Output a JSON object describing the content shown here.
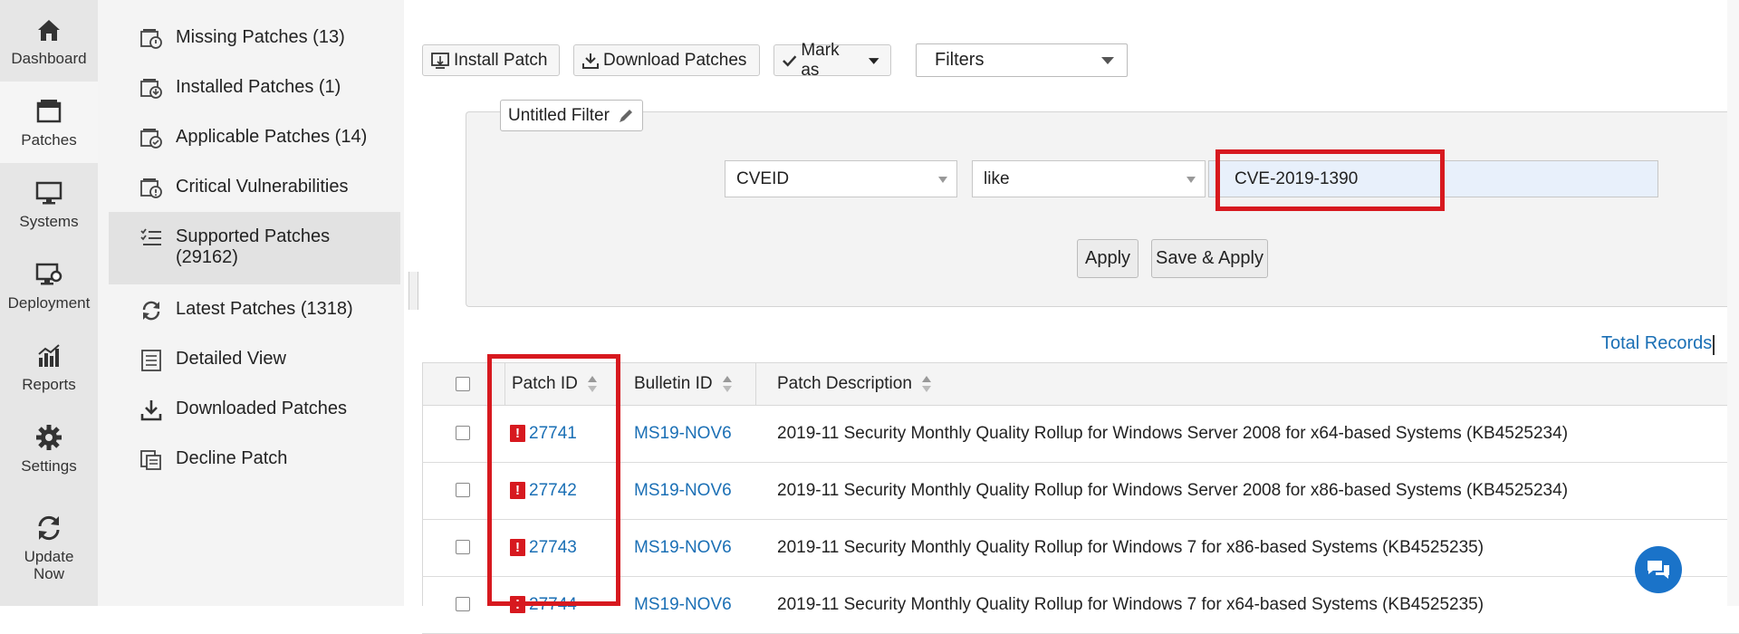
{
  "rail": {
    "items": [
      {
        "label": "Dashboard",
        "icon": "home-icon"
      },
      {
        "label": "Patches",
        "icon": "patches-icon",
        "active": true
      },
      {
        "label": "Systems",
        "icon": "monitor-icon"
      },
      {
        "label": "Deployment",
        "icon": "deployment-icon"
      },
      {
        "label": "Reports",
        "icon": "reports-icon"
      },
      {
        "label": "Settings",
        "icon": "gear-icon"
      },
      {
        "label": "Update Now",
        "icon": "refresh-icon"
      }
    ]
  },
  "sidebar": {
    "items": [
      {
        "label": "Missing Patches (13)",
        "icon": "missing-patches-icon"
      },
      {
        "label": "Installed Patches (1)",
        "icon": "installed-patches-icon"
      },
      {
        "label": "Applicable Patches (14)",
        "icon": "applicable-patches-icon"
      },
      {
        "label": "Critical Vulnerabilities",
        "icon": "critical-vulnerabilities-icon"
      },
      {
        "label": "Supported Patches",
        "label2": "(29162)",
        "icon": "checklist-icon",
        "active": true
      },
      {
        "label": "Latest Patches (1318)",
        "icon": "refresh-icon"
      },
      {
        "label": "Detailed View",
        "icon": "list-icon"
      },
      {
        "label": "Downloaded Patches",
        "icon": "download-icon"
      },
      {
        "label": "Decline Patch",
        "icon": "decline-icon"
      }
    ]
  },
  "toolbar": {
    "install_label": "Install Patch",
    "download_label": "Download Patches",
    "mark_label": "Mark as",
    "filters_value": "Filters"
  },
  "filter": {
    "name": "Untitled Filter",
    "field_value": "CVEID",
    "operator_value": "like",
    "search_value": "CVE-2019-1390",
    "apply_label": "Apply",
    "save_apply_label": "Save & Apply"
  },
  "total_label": "Total Records",
  "table": {
    "headers": [
      "Patch ID",
      "Bulletin ID",
      "Patch Description"
    ],
    "rows": [
      {
        "patch_id": "27741",
        "bulletin": "MS19-NOV6",
        "desc": "2019-11 Security Monthly Quality Rollup for Windows Server 2008 for x64-based Systems (KB4525234)"
      },
      {
        "patch_id": "27742",
        "bulletin": "MS19-NOV6",
        "desc": "2019-11 Security Monthly Quality Rollup for Windows Server 2008 for x86-based Systems (KB4525234)"
      },
      {
        "patch_id": "27743",
        "bulletin": "MS19-NOV6",
        "desc": "2019-11 Security Monthly Quality Rollup for Windows 7 for x86-based Systems (KB4525235)"
      },
      {
        "patch_id": "27744",
        "bulletin": "MS19-NOV6",
        "desc": "2019-11 Security Monthly Quality Rollup for Windows 7 for x64-based Systems (KB4525235)"
      }
    ]
  },
  "colors": {
    "accent": "#1a6fb5",
    "highlight": "#d7191f",
    "critical": "#d7191f"
  }
}
